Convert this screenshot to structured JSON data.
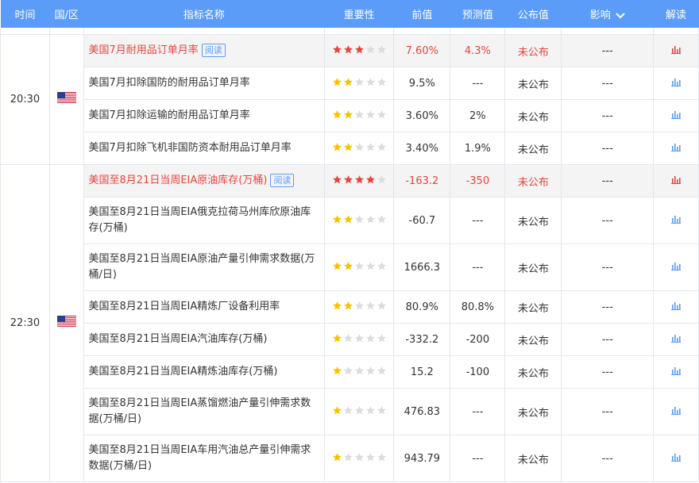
{
  "header": {
    "time": "时间",
    "country": "国/区",
    "indicator": "指标名称",
    "importance": "重要性",
    "previous": "前值",
    "forecast": "预测值",
    "actual": "公布值",
    "impact": "影响",
    "interpret": "解读"
  },
  "read_label": "阅读",
  "colors": {
    "accent": "#5b9cf8",
    "highlight": "#e6443f",
    "star_on_normal": "#f5c400",
    "star_off": "#dcdcdc"
  },
  "groups": [
    {
      "time": "20:30",
      "flag": "us-flag-icon",
      "rows": [
        {
          "name": "美国7月耐用品订单月率",
          "stars": 3,
          "prev": "7.60%",
          "forecast": "4.3%",
          "actual": "未公布",
          "impact": "---",
          "highlight": true,
          "read": true,
          "tall": false
        },
        {
          "name": "美国7月扣除国防的耐用品订单月率",
          "stars": 2,
          "prev": "9.5%",
          "forecast": "---",
          "actual": "未公布",
          "impact": "---",
          "highlight": false,
          "read": false,
          "tall": false
        },
        {
          "name": "美国7月扣除运输的耐用品订单月率",
          "stars": 2,
          "prev": "3.60%",
          "forecast": "2%",
          "actual": "未公布",
          "impact": "---",
          "highlight": false,
          "read": false,
          "tall": false
        },
        {
          "name": "美国7月扣除飞机非国防资本耐用品订单月率",
          "stars": 2,
          "prev": "3.40%",
          "forecast": "1.9%",
          "actual": "未公布",
          "impact": "---",
          "highlight": false,
          "read": false,
          "tall": false
        }
      ]
    },
    {
      "time": "22:30",
      "flag": "us-flag-icon",
      "rows": [
        {
          "name": "美国至8月21日当周EIA原油库存(万桶)",
          "stars": 4,
          "prev": "-163.2",
          "forecast": "-350",
          "actual": "未公布",
          "impact": "---",
          "highlight": true,
          "read": true,
          "tall": false
        },
        {
          "name": "美国至8月21日当周EIA俄克拉荷马州库欣原油库存(万桶)",
          "stars": 2,
          "prev": "-60.7",
          "forecast": "---",
          "actual": "未公布",
          "impact": "---",
          "highlight": false,
          "read": false,
          "tall": true
        },
        {
          "name": "美国至8月21日当周EIA原油产量引伸需求数据(万桶/日)",
          "stars": 2,
          "prev": "1666.3",
          "forecast": "---",
          "actual": "未公布",
          "impact": "---",
          "highlight": false,
          "read": false,
          "tall": true
        },
        {
          "name": "美国至8月21日当周EIA精炼厂设备利用率",
          "stars": 2,
          "prev": "80.9%",
          "forecast": "80.8%",
          "actual": "未公布",
          "impact": "---",
          "highlight": false,
          "read": false,
          "tall": false
        },
        {
          "name": "美国至8月21日当周EIA汽油库存(万桶)",
          "stars": 1,
          "prev": "-332.2",
          "forecast": "-200",
          "actual": "未公布",
          "impact": "---",
          "highlight": false,
          "read": false,
          "tall": false
        },
        {
          "name": "美国至8月21日当周EIA精炼油库存(万桶)",
          "stars": 1,
          "prev": "15.2",
          "forecast": "-100",
          "actual": "未公布",
          "impact": "---",
          "highlight": false,
          "read": false,
          "tall": false
        },
        {
          "name": "美国至8月21日当周EIA蒸馏燃油产量引伸需求数据(万桶/日)",
          "stars": 1,
          "prev": "476.83",
          "forecast": "---",
          "actual": "未公布",
          "impact": "---",
          "highlight": false,
          "read": false,
          "tall": true
        },
        {
          "name": "美国至8月21日当周EIA车用汽油总产量引伸需求数据(万桶/日)",
          "stars": 1,
          "prev": "943.79",
          "forecast": "---",
          "actual": "未公布",
          "impact": "---",
          "highlight": false,
          "read": false,
          "tall": true
        }
      ]
    }
  ]
}
